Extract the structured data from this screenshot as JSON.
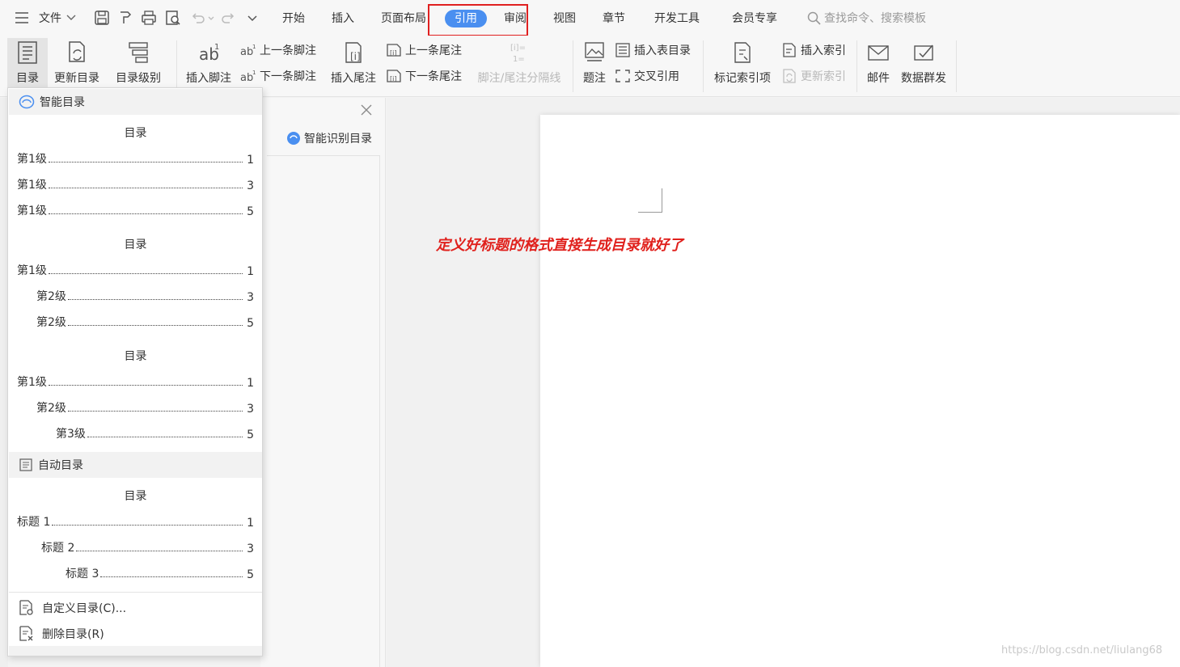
{
  "menubar": {
    "file_label": "文件",
    "tabs": [
      {
        "label": "开始"
      },
      {
        "label": "插入"
      },
      {
        "label": "页面布局"
      },
      {
        "label": "引用"
      },
      {
        "label": "审阅"
      },
      {
        "label": "视图"
      },
      {
        "label": "章节"
      },
      {
        "label": "开发工具"
      },
      {
        "label": "会员专享"
      }
    ],
    "active_tab": "引用",
    "search_placeholder": "查找命令、搜索模板"
  },
  "ribbon": {
    "toc": "目录",
    "update_toc": "更新目录",
    "toc_level": "目录级别",
    "insert_footnote": "插入脚注",
    "prev_footnote": "上一条脚注",
    "next_footnote": "下一条脚注",
    "insert_endnote": "插入尾注",
    "prev_endnote": "上一条尾注",
    "next_endnote": "下一条尾注",
    "separator": "脚注/尾注分隔线",
    "caption": "题注",
    "insert_table_of_figures": "插入表目录",
    "cross_reference": "交叉引用",
    "mark_index_entry": "标记索引项",
    "insert_index": "插入索引",
    "update_index": "更新索引",
    "mail": "邮件",
    "mail_merge": "数据群发"
  },
  "toc_dropdown": {
    "smart_header": "智能目录",
    "smart_previews": [
      {
        "title": "目录",
        "lines": [
          {
            "text": "第1级",
            "page": "1"
          },
          {
            "text": "第1级",
            "page": "3"
          },
          {
            "text": "第1级",
            "page": "5"
          }
        ]
      },
      {
        "title": "目录",
        "lines": [
          {
            "text": "第1级",
            "page": "1"
          },
          {
            "text": "第2级",
            "page": "3"
          },
          {
            "text": "第2级",
            "page": "5"
          }
        ]
      },
      {
        "title": "目录",
        "lines": [
          {
            "text": "第1级",
            "page": "1"
          },
          {
            "text": "第2级",
            "page": "3"
          },
          {
            "text": "第3级",
            "page": "5"
          }
        ]
      }
    ],
    "auto_header": "自动目录",
    "auto_preview": {
      "title": "目录",
      "lines": [
        {
          "text": "标题 1",
          "page": "1"
        },
        {
          "text": "标题 2",
          "page": "3"
        },
        {
          "text": "标题 3",
          "page": "5"
        }
      ]
    },
    "custom_toc": "自定义目录(C)...",
    "delete_toc": "删除目录(R)"
  },
  "nav_pane": {
    "smart_recognize": "智能识别目录"
  },
  "document": {
    "annotation": "定义好标题的格式直接生成目录就好了"
  },
  "watermark": "https://blog.csdn.net/liulang68",
  "colors": {
    "accent": "#4a8ff0",
    "highlight_box": "#e02020",
    "annotation": "#e0201c"
  }
}
